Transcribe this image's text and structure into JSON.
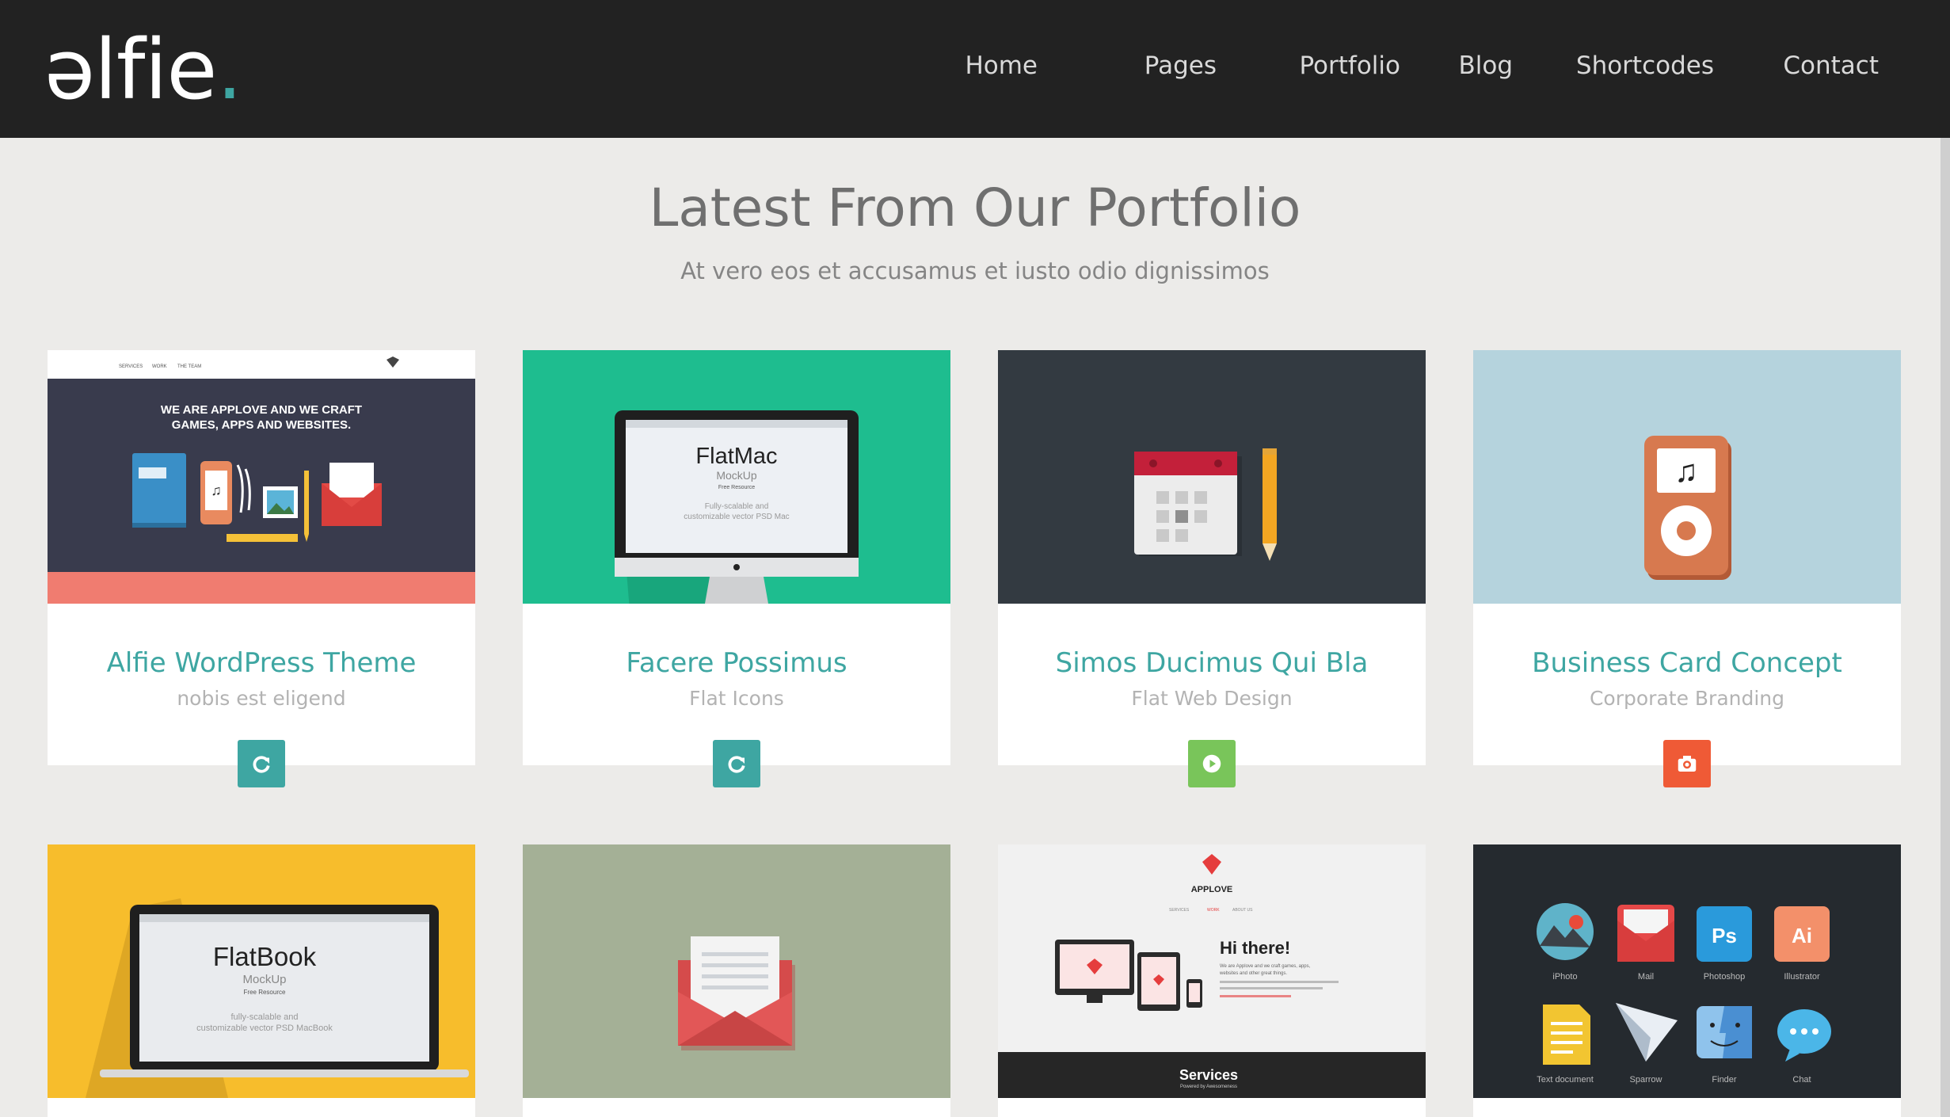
{
  "header": {
    "logo": {
      "text": "əlfie",
      "dot": "."
    },
    "nav": [
      "Home",
      "Pages",
      "Portfolio",
      "Blog",
      "Shortcodes",
      "Contact"
    ]
  },
  "section": {
    "title": "Latest From Our Portfolio",
    "subtitle": "At vero eos et accusamus et iusto odio dignissimos"
  },
  "cards": [
    {
      "title": "Alfie WordPress Theme",
      "subtitle": "nobis est eligend",
      "button_icon": "refresh-icon",
      "button_color": "#3ea6a2",
      "thumb": {
        "nav": [
          "SERVICES",
          "WORK",
          "THE TEAM"
        ],
        "headline1": "WE ARE APPLOVE AND WE CRAFT",
        "headline2": "GAMES, APPS AND WEBSITES."
      }
    },
    {
      "title": "Facere Possimus",
      "subtitle": "Flat Icons",
      "button_icon": "refresh-icon",
      "button_color": "#3ea6a2",
      "thumb": {
        "name": "FlatMac",
        "mockup": "MockUp",
        "resource": "Free Resource",
        "desc1": "Fully-scalable and",
        "desc2": "customizable vector PSD Mac"
      }
    },
    {
      "title": "Simos Ducimus Qui Bla",
      "subtitle": "Flat Web Design",
      "button_icon": "play-icon",
      "button_color": "#79c55a"
    },
    {
      "title": "Business Card Concept",
      "subtitle": "Corporate Branding",
      "button_icon": "camera-icon",
      "button_color": "#ef5a36"
    },
    {
      "thumb": {
        "name": "FlatBook",
        "mockup": "MockUp",
        "resource": "Free Resource",
        "desc1": "fully-scalable and",
        "desc2": "customizable vector PSD MacBook"
      }
    },
    {},
    {
      "thumb": {
        "brand": "APPLOVE",
        "nav": [
          "SERVICES",
          "WORK",
          "ABOUT US"
        ],
        "greeting": "Hi there!",
        "body1": "We are Applove and we craft games, apps,",
        "body2": "websites and other great things.",
        "footer_title": "Services",
        "footer_sub": "Powered by Awesomeness"
      }
    },
    {
      "thumb": {
        "icons": [
          {
            "label": "iPhoto"
          },
          {
            "label": "Mail"
          },
          {
            "label": "Photoshop",
            "glyph": "Ps"
          },
          {
            "label": "Illustrator",
            "glyph": "Ai"
          },
          {
            "label": "Text document"
          },
          {
            "label": "Sparrow"
          },
          {
            "label": "Finder"
          },
          {
            "label": "Chat"
          }
        ]
      }
    }
  ]
}
